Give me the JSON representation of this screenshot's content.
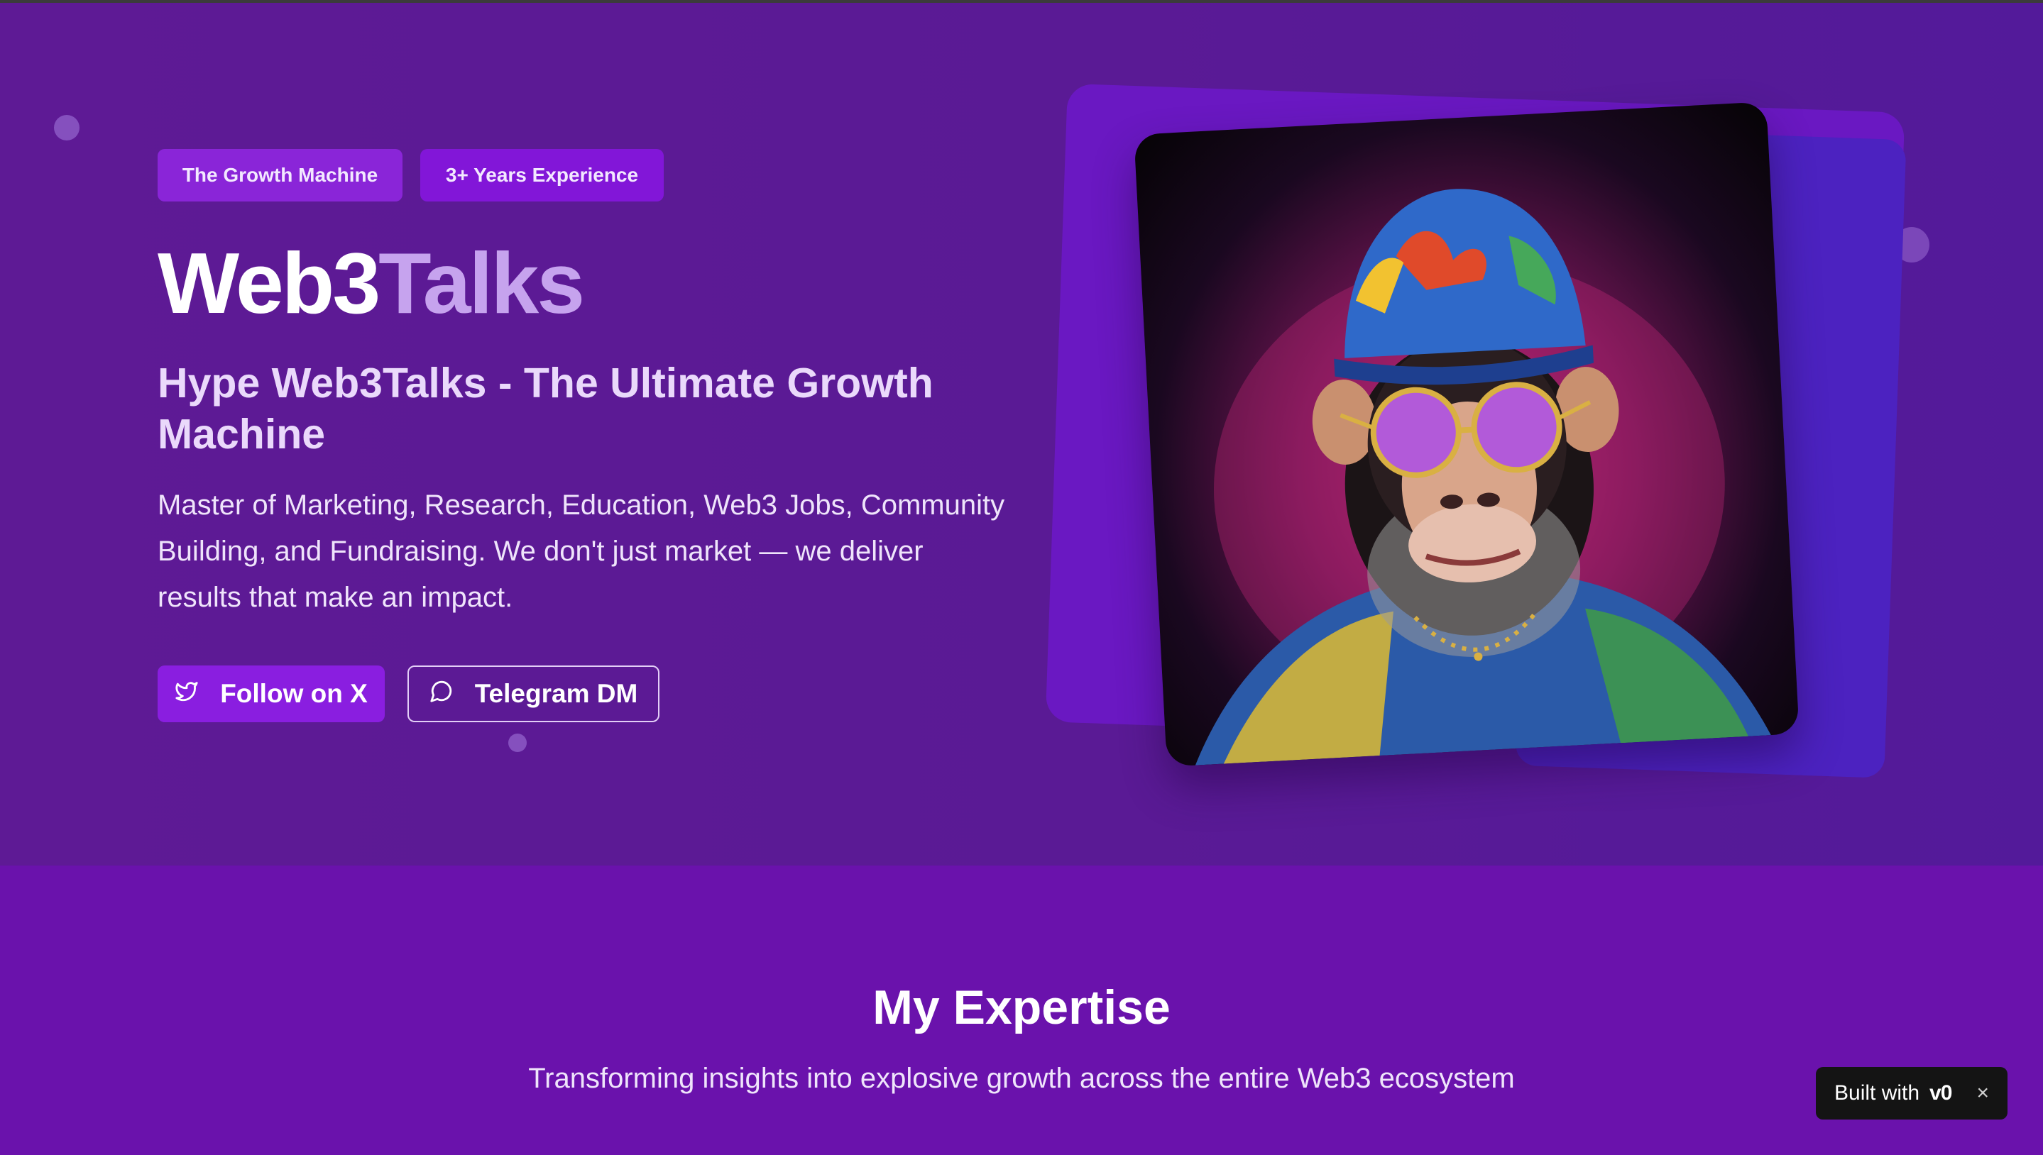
{
  "hero": {
    "badges": [
      "The Growth Machine",
      "3+ Years Experience"
    ],
    "title_part1": "Web3",
    "title_part2": "Talks",
    "subtitle": "Hype Web3Talks - The Ultimate Growth Machine",
    "description": "Master of Marketing, Research, Education, Web3 Jobs, Community Building, and Fundraising. We don't just market — we deliver results that make an impact.",
    "buttons": {
      "follow_label": "Follow on X",
      "follow_icon": "twitter-bird-icon",
      "telegram_label": "Telegram DM",
      "telegram_icon": "message-circle-icon"
    },
    "image_subject": "chimpanzee in sunglasses, bucket hat and floral shirt"
  },
  "expertise": {
    "heading": "My Expertise",
    "lead": "Transforming insights into explosive growth across the entire Web3 ecosystem"
  },
  "builtwith": {
    "label": "Built with",
    "logo": "v0",
    "close": "×"
  },
  "colors": {
    "hero_bg": "#5a1a95",
    "section_bg": "#6a12ac",
    "accent": "#8a1ee0",
    "title_accent": "#c6a3ee"
  }
}
